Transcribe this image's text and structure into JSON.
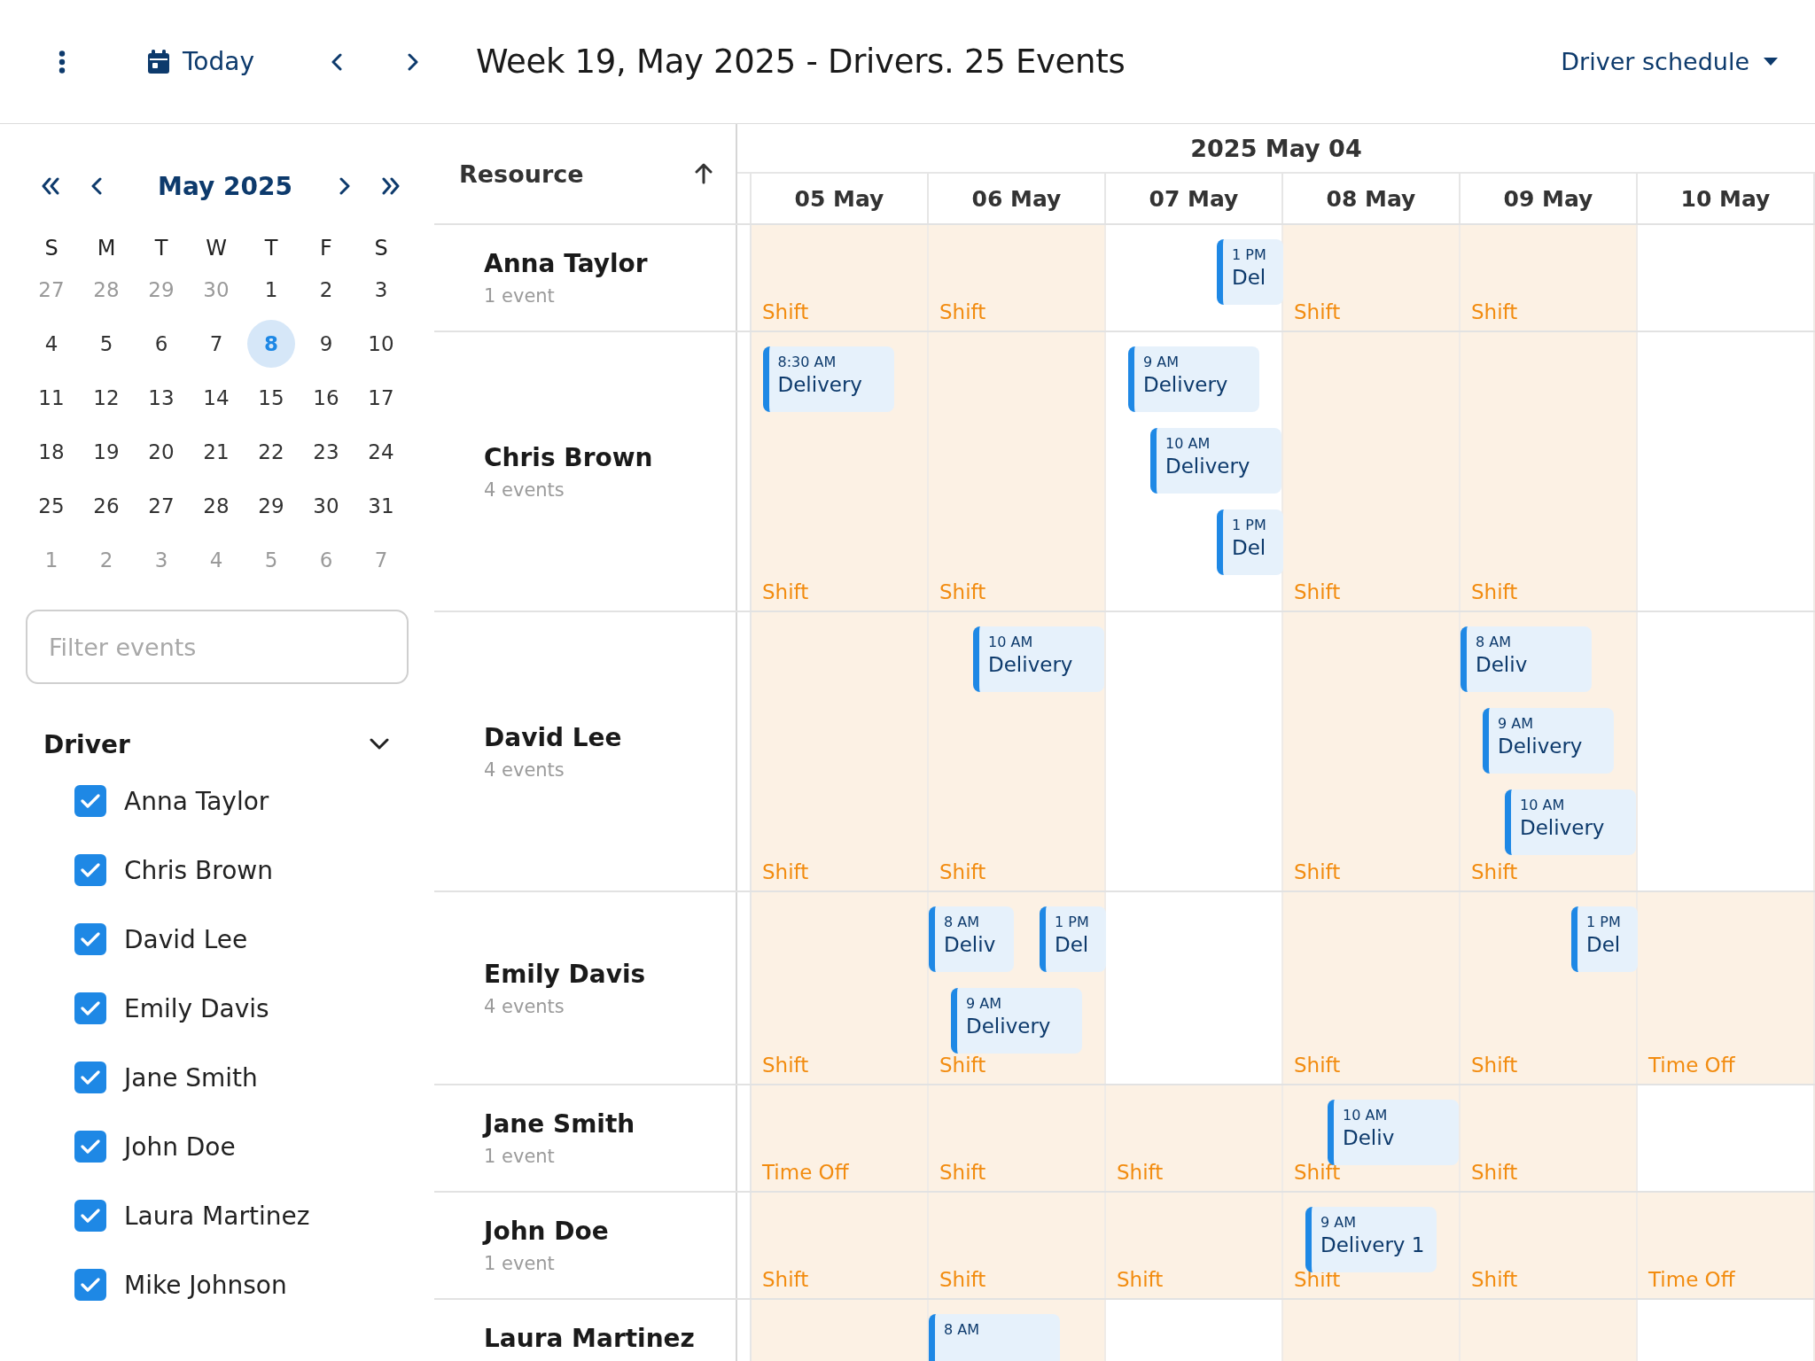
{
  "toolbar": {
    "today": "Today",
    "title": "Week 19, May 2025 - Drivers. 25 Events",
    "view": "Driver schedule"
  },
  "mini_calendar": {
    "month": "May 2025",
    "weekdays": [
      "S",
      "M",
      "T",
      "W",
      "T",
      "F",
      "S"
    ],
    "weeks": [
      [
        {
          "label": "27",
          "muted": true,
          "selected": false
        },
        {
          "label": "28",
          "muted": true,
          "selected": false
        },
        {
          "label": "29",
          "muted": true,
          "selected": false
        },
        {
          "label": "30",
          "muted": true,
          "selected": false
        },
        {
          "label": "1",
          "muted": false,
          "selected": false
        },
        {
          "label": "2",
          "muted": false,
          "selected": false
        },
        {
          "label": "3",
          "muted": false,
          "selected": false
        }
      ],
      [
        {
          "label": "4",
          "muted": false,
          "selected": false
        },
        {
          "label": "5",
          "muted": false,
          "selected": false
        },
        {
          "label": "6",
          "muted": false,
          "selected": false
        },
        {
          "label": "7",
          "muted": false,
          "selected": false
        },
        {
          "label": "8",
          "muted": false,
          "selected": true
        },
        {
          "label": "9",
          "muted": false,
          "selected": false
        },
        {
          "label": "10",
          "muted": false,
          "selected": false
        }
      ],
      [
        {
          "label": "11",
          "muted": false,
          "selected": false
        },
        {
          "label": "12",
          "muted": false,
          "selected": false
        },
        {
          "label": "13",
          "muted": false,
          "selected": false
        },
        {
          "label": "14",
          "muted": false,
          "selected": false
        },
        {
          "label": "15",
          "muted": false,
          "selected": false
        },
        {
          "label": "16",
          "muted": false,
          "selected": false
        },
        {
          "label": "17",
          "muted": false,
          "selected": false
        }
      ],
      [
        {
          "label": "18",
          "muted": false,
          "selected": false
        },
        {
          "label": "19",
          "muted": false,
          "selected": false
        },
        {
          "label": "20",
          "muted": false,
          "selected": false
        },
        {
          "label": "21",
          "muted": false,
          "selected": false
        },
        {
          "label": "22",
          "muted": false,
          "selected": false
        },
        {
          "label": "23",
          "muted": false,
          "selected": false
        },
        {
          "label": "24",
          "muted": false,
          "selected": false
        }
      ],
      [
        {
          "label": "25",
          "muted": false,
          "selected": false
        },
        {
          "label": "26",
          "muted": false,
          "selected": false
        },
        {
          "label": "27",
          "muted": false,
          "selected": false
        },
        {
          "label": "28",
          "muted": false,
          "selected": false
        },
        {
          "label": "29",
          "muted": false,
          "selected": false
        },
        {
          "label": "30",
          "muted": false,
          "selected": false
        },
        {
          "label": "31",
          "muted": false,
          "selected": false
        }
      ],
      [
        {
          "label": "1",
          "muted": true,
          "selected": false
        },
        {
          "label": "2",
          "muted": true,
          "selected": false
        },
        {
          "label": "3",
          "muted": true,
          "selected": false
        },
        {
          "label": "4",
          "muted": true,
          "selected": false
        },
        {
          "label": "5",
          "muted": true,
          "selected": false
        },
        {
          "label": "6",
          "muted": true,
          "selected": false
        },
        {
          "label": "7",
          "muted": true,
          "selected": false
        }
      ]
    ]
  },
  "filter": {
    "placeholder": "Filter events"
  },
  "driver_filter": {
    "title": "Driver",
    "expanded": true,
    "items": [
      {
        "label": "Anna Taylor",
        "checked": true
      },
      {
        "label": "Chris Brown",
        "checked": true
      },
      {
        "label": "David Lee",
        "checked": true
      },
      {
        "label": "Emily Davis",
        "checked": true
      },
      {
        "label": "Jane Smith",
        "checked": true
      },
      {
        "label": "John Doe",
        "checked": true
      },
      {
        "label": "Laura Martinez",
        "checked": true
      },
      {
        "label": "Mike Johnson",
        "checked": true
      }
    ]
  },
  "scheduler": {
    "resource_header": "Resource",
    "week_header": "2025 May 04",
    "days": [
      "05 May",
      "06 May",
      "07 May",
      "08 May",
      "09 May",
      "10 May"
    ],
    "rows": [
      {
        "name": "Anna Taylor",
        "count": "1 event",
        "cells": [
          {
            "shaded": true,
            "label": "Shift"
          },
          {
            "shaded": true,
            "label": "Shift"
          },
          {
            "shaded": false,
            "lanes": [
              [
                {
                  "time": "1 PM",
                  "title": "Del"
                }
              ]
            ]
          },
          {
            "shaded": true,
            "label": "Shift"
          },
          {
            "shaded": true,
            "label": "Shift"
          },
          {
            "shaded": false
          }
        ]
      },
      {
        "name": "Chris Brown",
        "count": "4 events",
        "cells": [
          {
            "shaded": true,
            "label": "Shift",
            "lanes": [
              [
                {
                  "time": "8:30 AM",
                  "title": "Delivery"
                }
              ]
            ]
          },
          {
            "shaded": true,
            "label": "Shift"
          },
          {
            "shaded": false,
            "lanes": [
              [
                {
                  "time": "9 AM",
                  "title": "Delivery"
                }
              ],
              [
                {
                  "time": "10 AM",
                  "title": "Delivery"
                }
              ],
              [
                {
                  "time": "1 PM",
                  "title": "Del"
                }
              ]
            ]
          },
          {
            "shaded": true,
            "label": "Shift"
          },
          {
            "shaded": true,
            "label": "Shift"
          },
          {
            "shaded": false
          }
        ]
      },
      {
        "name": "David Lee",
        "count": "4 events",
        "cells": [
          {
            "shaded": true,
            "label": "Shift"
          },
          {
            "shaded": true,
            "label": "Shift",
            "lanes": [
              [
                {
                  "time": "10 AM",
                  "title": "Delivery"
                }
              ]
            ]
          },
          {
            "shaded": false
          },
          {
            "shaded": true,
            "label": "Shift"
          },
          {
            "shaded": true,
            "label": "Shift",
            "lanes": [
              [
                {
                  "time": "8 AM",
                  "title": "Deliv"
                }
              ],
              [
                {
                  "time": "9 AM",
                  "title": "Delivery"
                }
              ],
              [
                {
                  "time": "10 AM",
                  "title": "Delivery"
                }
              ]
            ]
          },
          {
            "shaded": false
          }
        ]
      },
      {
        "name": "Emily Davis",
        "count": "4 events",
        "cells": [
          {
            "shaded": true,
            "label": "Shift"
          },
          {
            "shaded": true,
            "label": "Shift",
            "lanes": [
              [
                {
                  "time": "8 AM",
                  "title": "Deliv"
                },
                {
                  "time": "1 PM",
                  "title": "Del"
                }
              ],
              [
                {
                  "time": "9 AM",
                  "title": "Delivery"
                }
              ]
            ]
          },
          {
            "shaded": false
          },
          {
            "shaded": true,
            "label": "Shift"
          },
          {
            "shaded": true,
            "label": "Shift",
            "lanes": [
              [
                {
                  "time": "1 PM",
                  "title": "Del"
                }
              ]
            ]
          },
          {
            "shaded": true,
            "label": "Time Off"
          }
        ]
      },
      {
        "name": "Jane Smith",
        "count": "1 event",
        "cells": [
          {
            "shaded": true,
            "label": "Time Off"
          },
          {
            "shaded": true,
            "label": "Shift"
          },
          {
            "shaded": true,
            "label": "Shift"
          },
          {
            "shaded": true,
            "label": "Shift",
            "lanes": [
              [
                {
                  "time": "10 AM",
                  "title": "Deliv"
                }
              ]
            ]
          },
          {
            "shaded": true,
            "label": "Shift"
          },
          {
            "shaded": false
          }
        ]
      },
      {
        "name": "John Doe",
        "count": "1 event",
        "cells": [
          {
            "shaded": true,
            "label": "Shift"
          },
          {
            "shaded": true,
            "label": "Shift"
          },
          {
            "shaded": true,
            "label": "Shift"
          },
          {
            "shaded": true,
            "label": "Shift",
            "lanes": [
              [
                {
                  "time": "9 AM",
                  "title": "Delivery 1"
                }
              ]
            ]
          },
          {
            "shaded": true,
            "label": "Shift"
          },
          {
            "shaded": true,
            "label": "Time Off"
          }
        ]
      },
      {
        "name": "Laura Martinez",
        "cells": [
          {
            "shaded": true
          },
          {
            "shaded": true,
            "lanes": [
              [
                {
                  "time": "8 AM"
                }
              ]
            ]
          },
          {
            "shaded": false
          },
          {
            "shaded": true
          },
          {
            "shaded": true
          },
          {
            "shaded": false
          }
        ]
      }
    ]
  }
}
